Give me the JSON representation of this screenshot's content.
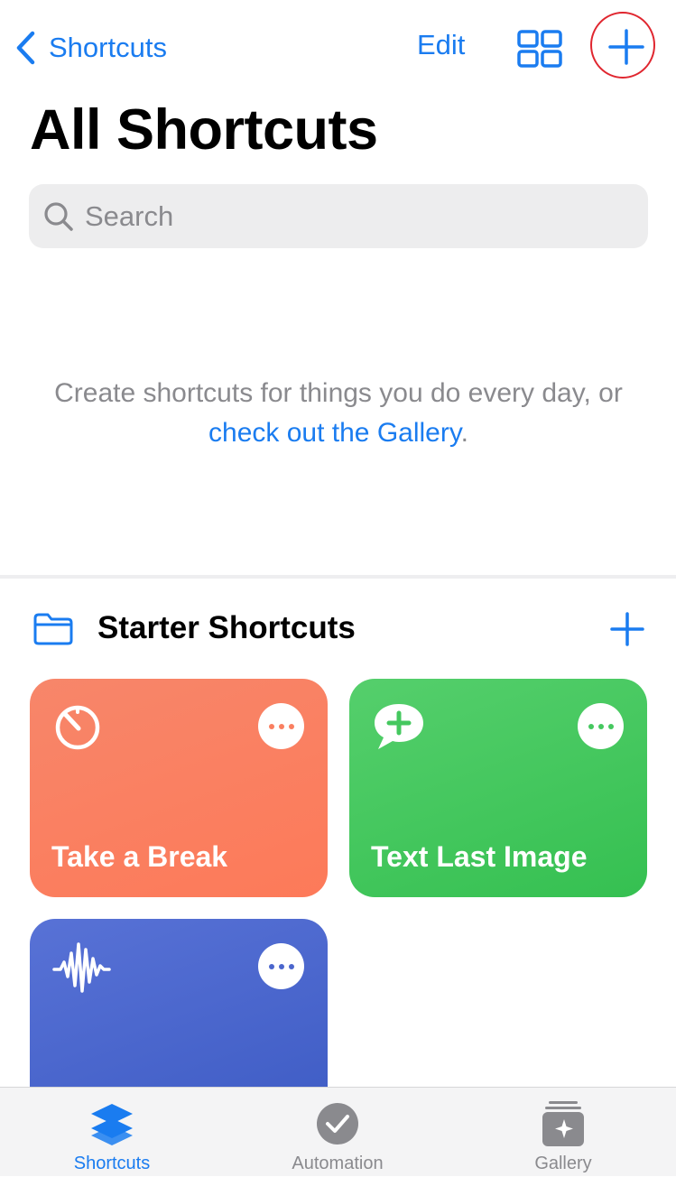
{
  "nav": {
    "back_label": "Shortcuts",
    "edit_label": "Edit",
    "grid_icon": "grid-view-icon",
    "add_icon": "plus-icon"
  },
  "page_title": "All Shortcuts",
  "search": {
    "placeholder": "Search"
  },
  "empty_state": {
    "text": "Create shortcuts for things you do every day, or ",
    "link": "check out the Gallery",
    "suffix": "."
  },
  "section": {
    "title": "Starter Shortcuts",
    "icon": "folder-icon",
    "add_icon": "plus-icon"
  },
  "cards": [
    {
      "title": "Take a Break",
      "icon": "timer-icon",
      "color": "#fa7f60"
    },
    {
      "title": "Text Last Image",
      "icon": "message-plus-icon",
      "color": "#45c85f"
    },
    {
      "title": "",
      "icon": "waveform-icon",
      "color": "#4b66cd"
    }
  ],
  "tabbar": {
    "tabs": [
      {
        "label": "Shortcuts",
        "icon": "layers-icon",
        "active": true
      },
      {
        "label": "Automation",
        "icon": "clock-check-icon",
        "active": false
      },
      {
        "label": "Gallery",
        "icon": "gallery-sparkle-icon",
        "active": false
      }
    ]
  },
  "colors": {
    "accent": "#1a7cf0",
    "annotation": "#e0262f",
    "inactive_tab": "#8a8a8e"
  }
}
